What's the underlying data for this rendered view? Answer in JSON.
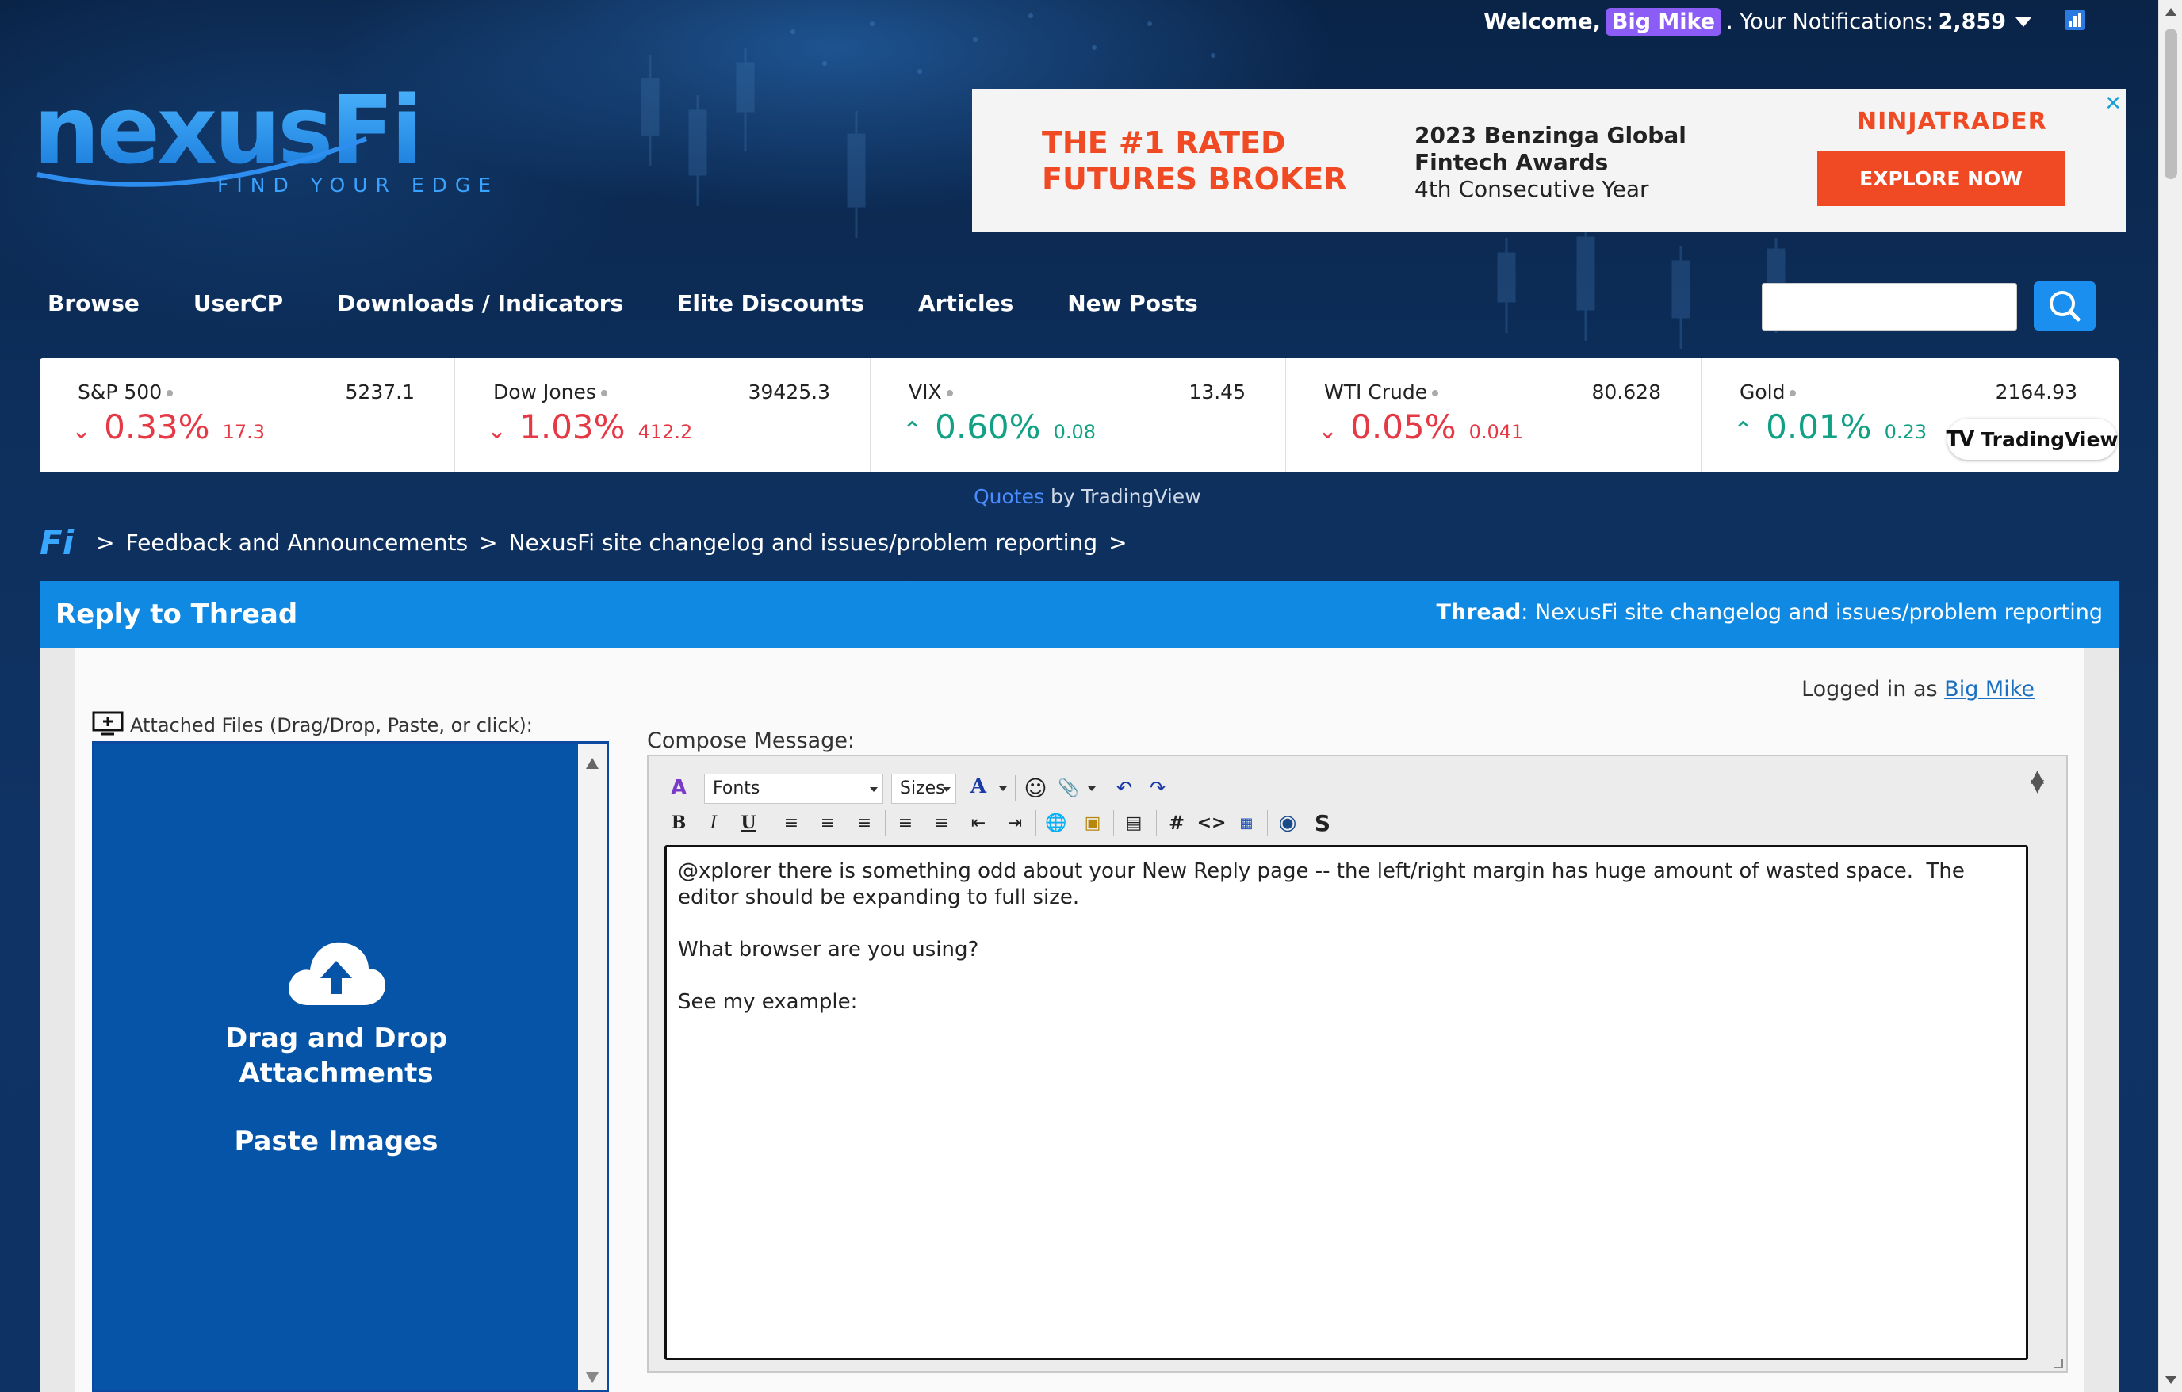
{
  "header": {
    "welcome_label": "Welcome,",
    "user_name": "Big Mike",
    "notifications_label": ". Your Notifications:",
    "notifications_count": "2,859"
  },
  "logo": {
    "name": "nexusFi",
    "tagline": "FIND YOUR EDGE"
  },
  "ad": {
    "headline_line1": "THE #1 RATED",
    "headline_line2": "FUTURES BROKER",
    "award_line1": "2023 Benzinga Global",
    "award_line2": "Fintech Awards",
    "award_line3": "4th Consecutive Year",
    "brand": "NINJATRADER",
    "cta": "EXPLORE NOW",
    "close": "✕"
  },
  "nav": {
    "items": [
      "Browse",
      "UserCP",
      "Downloads / Indicators",
      "Elite Discounts",
      "Articles",
      "New Posts"
    ],
    "search_placeholder": ""
  },
  "ticker": {
    "items": [
      {
        "name": "S&P 500",
        "price": "5237.1",
        "change_pct": "0.33%",
        "change_abs": "17.3",
        "direction": "down"
      },
      {
        "name": "Dow Jones",
        "price": "39425.3",
        "change_pct": "1.03%",
        "change_abs": "412.2",
        "direction": "down"
      },
      {
        "name": "VIX",
        "price": "13.45",
        "change_pct": "0.60%",
        "change_abs": "0.08",
        "direction": "up"
      },
      {
        "name": "WTI Crude",
        "price": "80.628",
        "change_pct": "0.05%",
        "change_abs": "0.041",
        "direction": "down"
      },
      {
        "name": "Gold",
        "price": "2164.93",
        "change_pct": "0.01%",
        "change_abs": "0.23",
        "direction": "up"
      }
    ],
    "badge": "TradingView",
    "badge_logo": "TV",
    "quotes_link": "Quotes",
    "quotes_suffix": " by TradingView"
  },
  "breadcrumb": {
    "home": "Fi",
    "items": [
      "Feedback and Announcements",
      "NexusFi site changelog and issues/problem reporting"
    ],
    "sep": ">"
  },
  "reply": {
    "title": "Reply to Thread",
    "thread_label": "Thread",
    "thread_name": ": NexusFi site changelog and issues/problem reporting",
    "logged_in_label": "Logged in as ",
    "logged_in_user": "Big Mike",
    "attach_label": "Attached Files (Drag/Drop, Paste, or click):",
    "dropzone_line1": "Drag and Drop",
    "dropzone_line2": "Attachments",
    "dropzone_line3": "Paste Images",
    "compose_label": "Compose Message:",
    "fonts_select": "Fonts",
    "sizes_select": "Sizes",
    "message": "@xplorer there is something odd about your New Reply page -- the left/right margin has huge amount of wasted space.  The editor should be expanding to full size.\n\nWhat browser are you using?\n\nSee my example:"
  },
  "colors": {
    "background": "#0c2a52",
    "accent": "#1089e2",
    "down": "#e53946",
    "up": "#12a185",
    "ad_orange": "#f04a24",
    "user_badge": "#8b5cf6"
  }
}
